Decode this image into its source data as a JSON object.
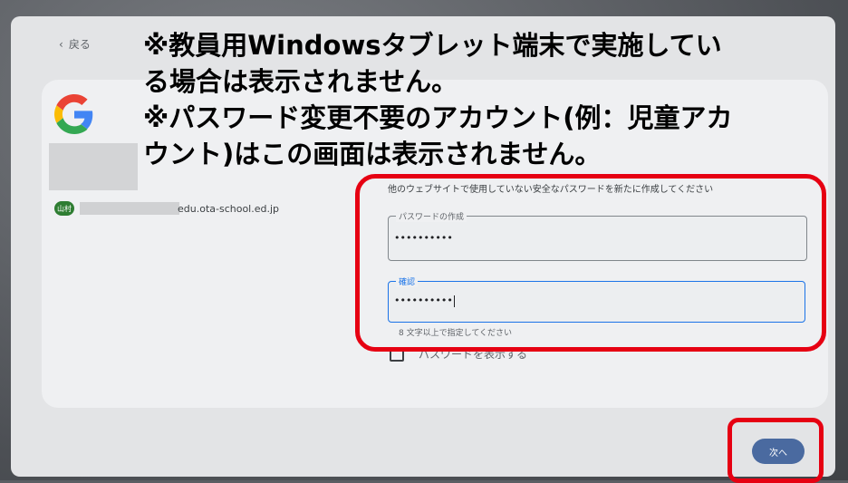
{
  "nav": {
    "back_label": "戻る"
  },
  "account": {
    "avatar_text": "山村",
    "email_suffix": "edu.ota-school.ed.jp"
  },
  "form": {
    "instruction": "他のウェブサイトで使用していない安全なパスワードを新たに作成してください",
    "password_label": "パスワードの作成",
    "password_value": "••••••••••",
    "confirm_label": "確認",
    "confirm_value": "••••••••••",
    "helper_text": "8 文字以上で指定してください",
    "show_password_label": "パスワードを表示する",
    "next_button": "次へ"
  },
  "overlay": {
    "line1": "※教員用Windowsタブレット端末で実施してい",
    "line2": "る場合は表示されません。",
    "line3": "※パスワード変更不要のアカウント(例：児童アカ",
    "line4": "ウント)はこの画面は表示されません。"
  },
  "colors": {
    "highlight": "#e60012",
    "primary_button": "#4a6aa0",
    "google_blue": "#4285F4"
  },
  "icons": [
    "chevron-left-icon",
    "google-logo-icon"
  ]
}
